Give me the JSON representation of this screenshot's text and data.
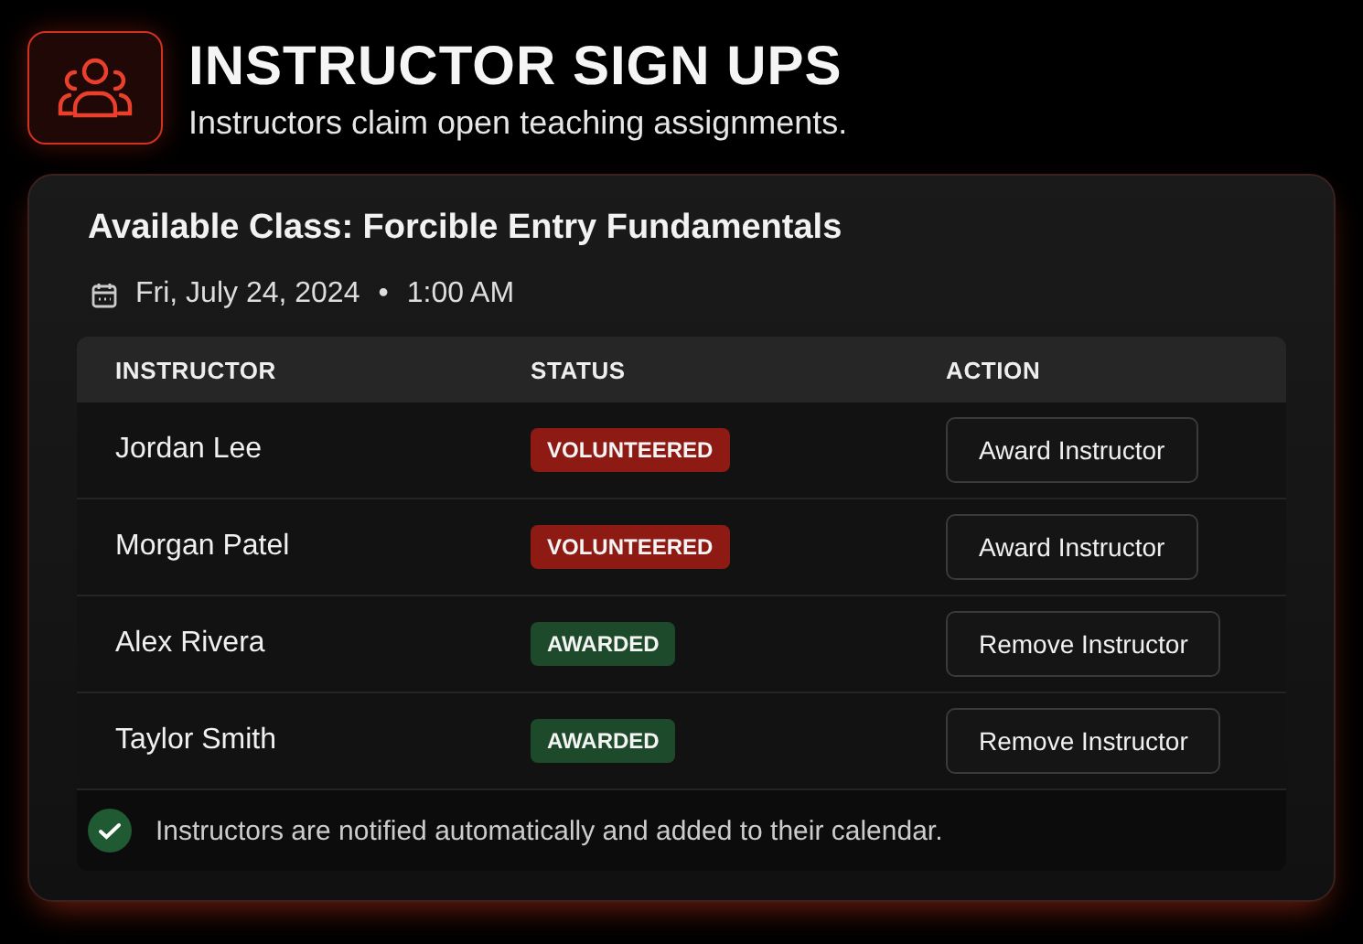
{
  "header": {
    "title": "INSTRUCTOR SIGN UPS",
    "subtitle": "Instructors claim open teaching assignments."
  },
  "card": {
    "title": "Available Class: Forcible Entry Fundamentals",
    "date": "Fri, July 24, 2024",
    "separator": "•",
    "time": "1:00 AM"
  },
  "table": {
    "columns": [
      "INSTRUCTOR",
      "STATUS",
      "ACTION"
    ],
    "rows": [
      {
        "name": "Jordan Lee",
        "status": {
          "kind": "volunteered",
          "label": "VOLUNTEERED"
        },
        "action": "Award Instructor"
      },
      {
        "name": "Morgan Patel",
        "status": {
          "kind": "volunteered",
          "label": "VOLUNTEERED"
        },
        "action": "Award Instructor"
      },
      {
        "name": "Alex Rivera",
        "status": {
          "kind": "awarded",
          "label": "AWARDED"
        },
        "action": "Remove Instructor"
      },
      {
        "name": "Taylor Smith",
        "status": {
          "kind": "awarded",
          "label": "AWARDED"
        },
        "action": "Remove Instructor"
      }
    ]
  },
  "footer_note": "Instructors are notified automatically and added to their calendar."
}
